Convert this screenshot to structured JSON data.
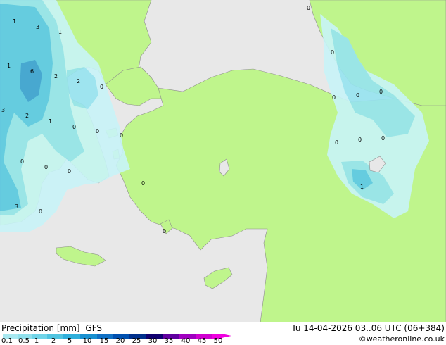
{
  "title": "Precipitation [mm]",
  "model": "GFS",
  "datetime": "Tu 14-04-2026 03..06 UTC (06+384)",
  "credit": "©weatheronline.co.uk",
  "scale": {
    "labels": [
      "0.1",
      "0.5",
      "1",
      "2",
      "5",
      "10",
      "15",
      "20",
      "25",
      "30",
      "35",
      "40",
      "45",
      "50"
    ],
    "colors": [
      "#a8e8f0",
      "#90e0ec",
      "#70d4e8",
      "#50c4e0",
      "#30b0dc",
      "#1890d0",
      "#1070c4",
      "#0050b0",
      "#00308c",
      "#100070",
      "#6000a0",
      "#a000c0",
      "#d000d0",
      "#f000e0"
    ]
  },
  "colors": {
    "land": "#bff58c",
    "sea": "#e8e8e8",
    "border": "#8c8c8c",
    "precip_light": "#c8f4f8",
    "precip_mid": "#96e4f0",
    "precip_heavy": "#5cc8e8",
    "precip_max": "#3ca0d8"
  },
  "map_labels": [
    {
      "text": "1",
      "type": "value"
    },
    {
      "text": "3",
      "type": "value"
    },
    {
      "text": "1",
      "type": "value"
    },
    {
      "text": "1",
      "type": "value"
    },
    {
      "text": "6",
      "type": "value"
    },
    {
      "text": "2",
      "type": "value"
    },
    {
      "text": "2",
      "type": "value"
    },
    {
      "text": "0",
      "type": "value"
    },
    {
      "text": "3",
      "type": "value"
    },
    {
      "text": "2",
      "type": "value"
    },
    {
      "text": "1",
      "type": "value"
    },
    {
      "text": "0",
      "type": "value"
    },
    {
      "text": "0",
      "type": "value"
    },
    {
      "text": "0",
      "type": "value"
    },
    {
      "text": "0",
      "type": "value"
    },
    {
      "text": "0",
      "type": "value"
    },
    {
      "text": "0",
      "type": "value"
    },
    {
      "text": "3",
      "type": "value"
    },
    {
      "text": "0",
      "type": "value"
    },
    {
      "text": "0",
      "type": "value"
    },
    {
      "text": "0",
      "type": "value"
    },
    {
      "text": "0",
      "type": "value"
    },
    {
      "text": "0",
      "type": "value"
    },
    {
      "text": "0",
      "type": "value"
    },
    {
      "text": "0",
      "type": "value"
    },
    {
      "text": "0",
      "type": "value"
    },
    {
      "text": "0",
      "type": "value"
    },
    {
      "text": "0",
      "type": "value"
    },
    {
      "text": "1",
      "type": "value"
    },
    {
      "text": "0",
      "type": "value"
    }
  ]
}
